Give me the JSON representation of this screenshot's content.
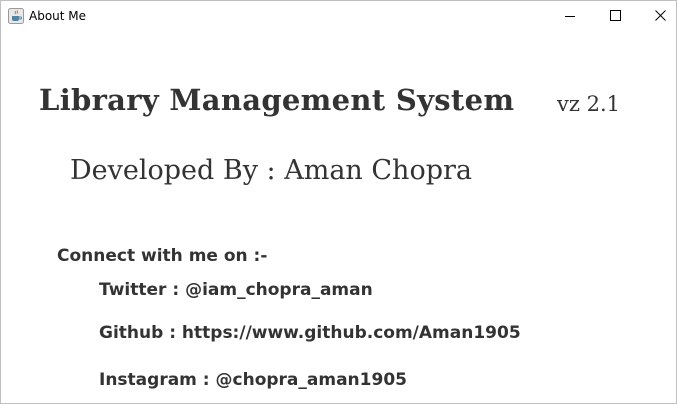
{
  "window": {
    "title": "About Me",
    "icon": "java-cup-icon",
    "controls": [
      "minimize-icon",
      "maximize-icon",
      "close-icon"
    ]
  },
  "about": {
    "app_name": "Library Management System",
    "version": "vz 2.1",
    "developer": "Developed By : Aman Chopra",
    "connect_heading": "Connect with me on :-",
    "twitter": "Twitter : @iam_chopra_aman",
    "github": "Github : https://www.github.com/Aman1905",
    "instagram": "Instagram : @chopra_aman1905"
  },
  "colors": {
    "text": "#333333",
    "background": "#ffffff"
  }
}
